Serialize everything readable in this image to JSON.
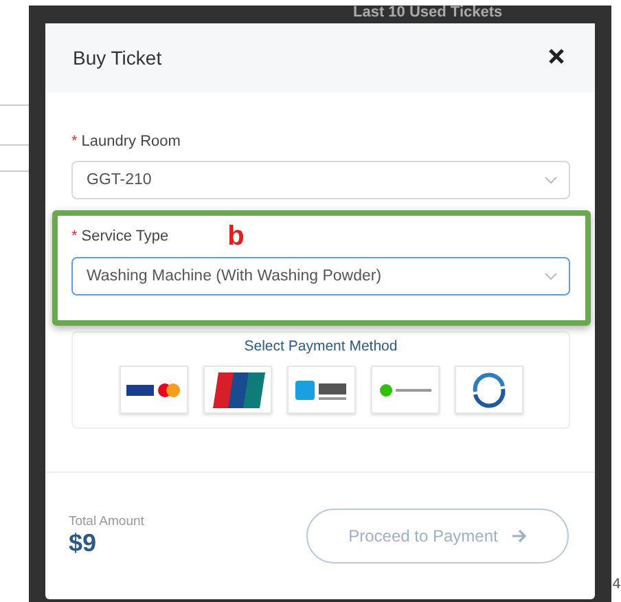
{
  "background": {
    "panel_title": "Last 10 Used Tickets",
    "corner_text": "4"
  },
  "dialog": {
    "title": "Buy Ticket",
    "fields": [
      {
        "label": "Laundry Room",
        "required_mark": "*",
        "value": "GGT-210",
        "focused": false,
        "highlighted": false
      },
      {
        "label": "Service Type",
        "required_mark": "*",
        "value": "Washing Machine (With Washing Powder)",
        "focused": true,
        "highlighted": true,
        "annotation": "b"
      }
    ],
    "payment": {
      "title": "Select Payment Method",
      "methods": [
        {
          "kind": "card"
        },
        {
          "kind": "unionpay"
        },
        {
          "kind": "alipay"
        },
        {
          "kind": "wechat"
        },
        {
          "kind": "fps"
        }
      ]
    },
    "total": {
      "label": "Total Amount",
      "amount": "$9"
    },
    "proceed_button": {
      "label": "Proceed to Payment",
      "disabled": true
    }
  }
}
